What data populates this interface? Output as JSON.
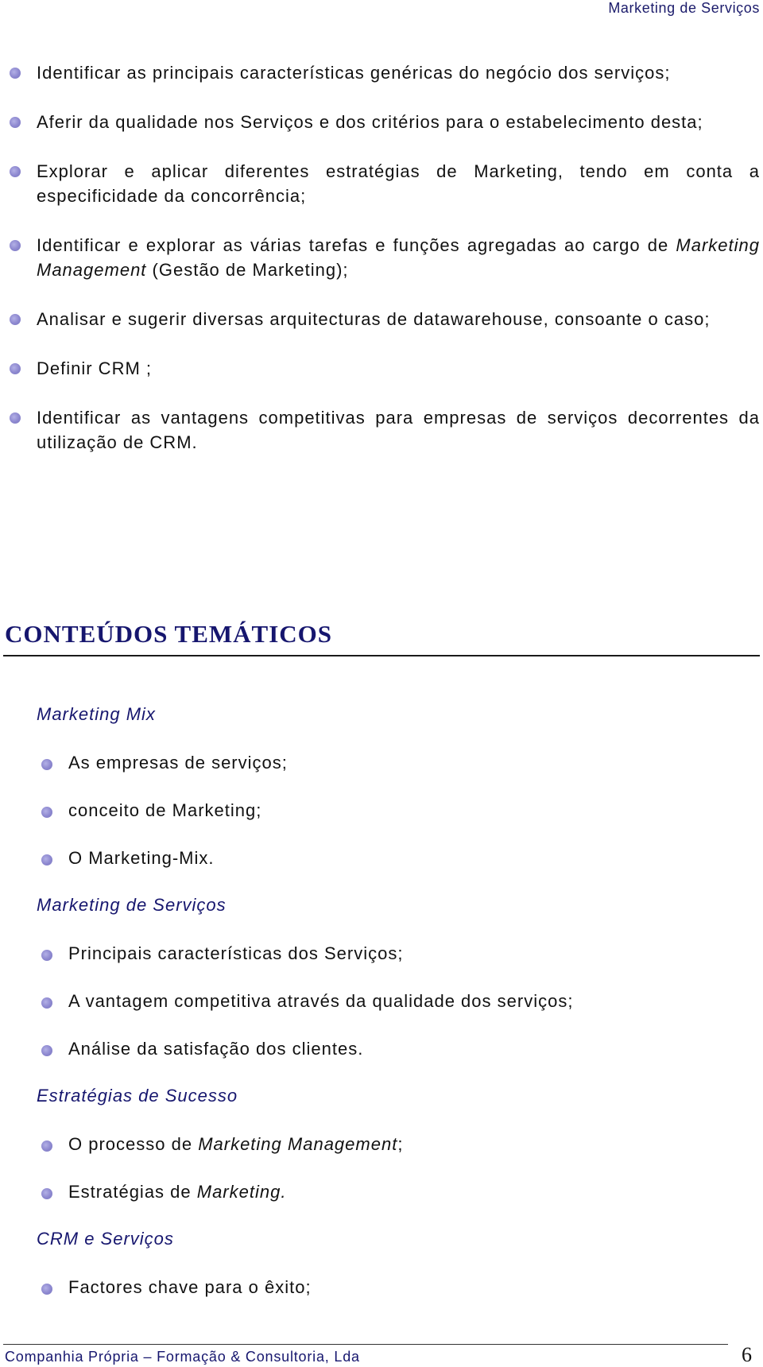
{
  "header": {
    "title": "Marketing de Serviços"
  },
  "objectives": [
    {
      "text": "Identificar as principais características genéricas do negócio dos serviços;"
    },
    {
      "text": "Aferir da qualidade nos Serviços e dos critérios para o estabelecimento desta;"
    },
    {
      "text": "Explorar e aplicar diferentes estratégias de Marketing, tendo em conta a especificidade da concorrência;"
    },
    {
      "text_before": "Identificar e explorar as várias tarefas e funções agregadas ao cargo de ",
      "text_italic": "Marketing Management",
      "text_after": " (Gestão de Marketing);"
    },
    {
      "text": "Analisar e sugerir diversas arquitecturas de datawarehouse, consoante o caso;"
    },
    {
      "text": "Definir CRM ;"
    },
    {
      "text": "Identificar as vantagens competitivas para empresas de serviços decorrentes da utilização de CRM."
    }
  ],
  "section": {
    "title": "CONTEÚDOS TEMÁTICOS"
  },
  "topics": [
    {
      "title": "Marketing Mix",
      "items": [
        {
          "text": "As empresas de serviços;"
        },
        {
          "text": "conceito de Marketing;"
        },
        {
          "text": "O Marketing-Mix."
        }
      ]
    },
    {
      "title": "Marketing de Serviços",
      "items": [
        {
          "text": "Principais características dos Serviços;"
        },
        {
          "text": "A vantagem competitiva através da qualidade dos serviços;"
        },
        {
          "text": "Análise da satisfação dos clientes."
        }
      ]
    },
    {
      "title": "Estratégias de Sucesso",
      "items": [
        {
          "text_before": "O processo de ",
          "text_italic": "Marketing Management",
          "text_after": ";"
        },
        {
          "text_before": "Estratégias de ",
          "text_italic": "Marketing.",
          "text_after": ""
        }
      ]
    },
    {
      "title": "CRM e Serviços",
      "items": [
        {
          "text": "Factores chave para o êxito;"
        }
      ]
    }
  ],
  "footer": {
    "company": "Companhia Própria – Formação & Consultoria, Lda",
    "page_number": "6"
  }
}
